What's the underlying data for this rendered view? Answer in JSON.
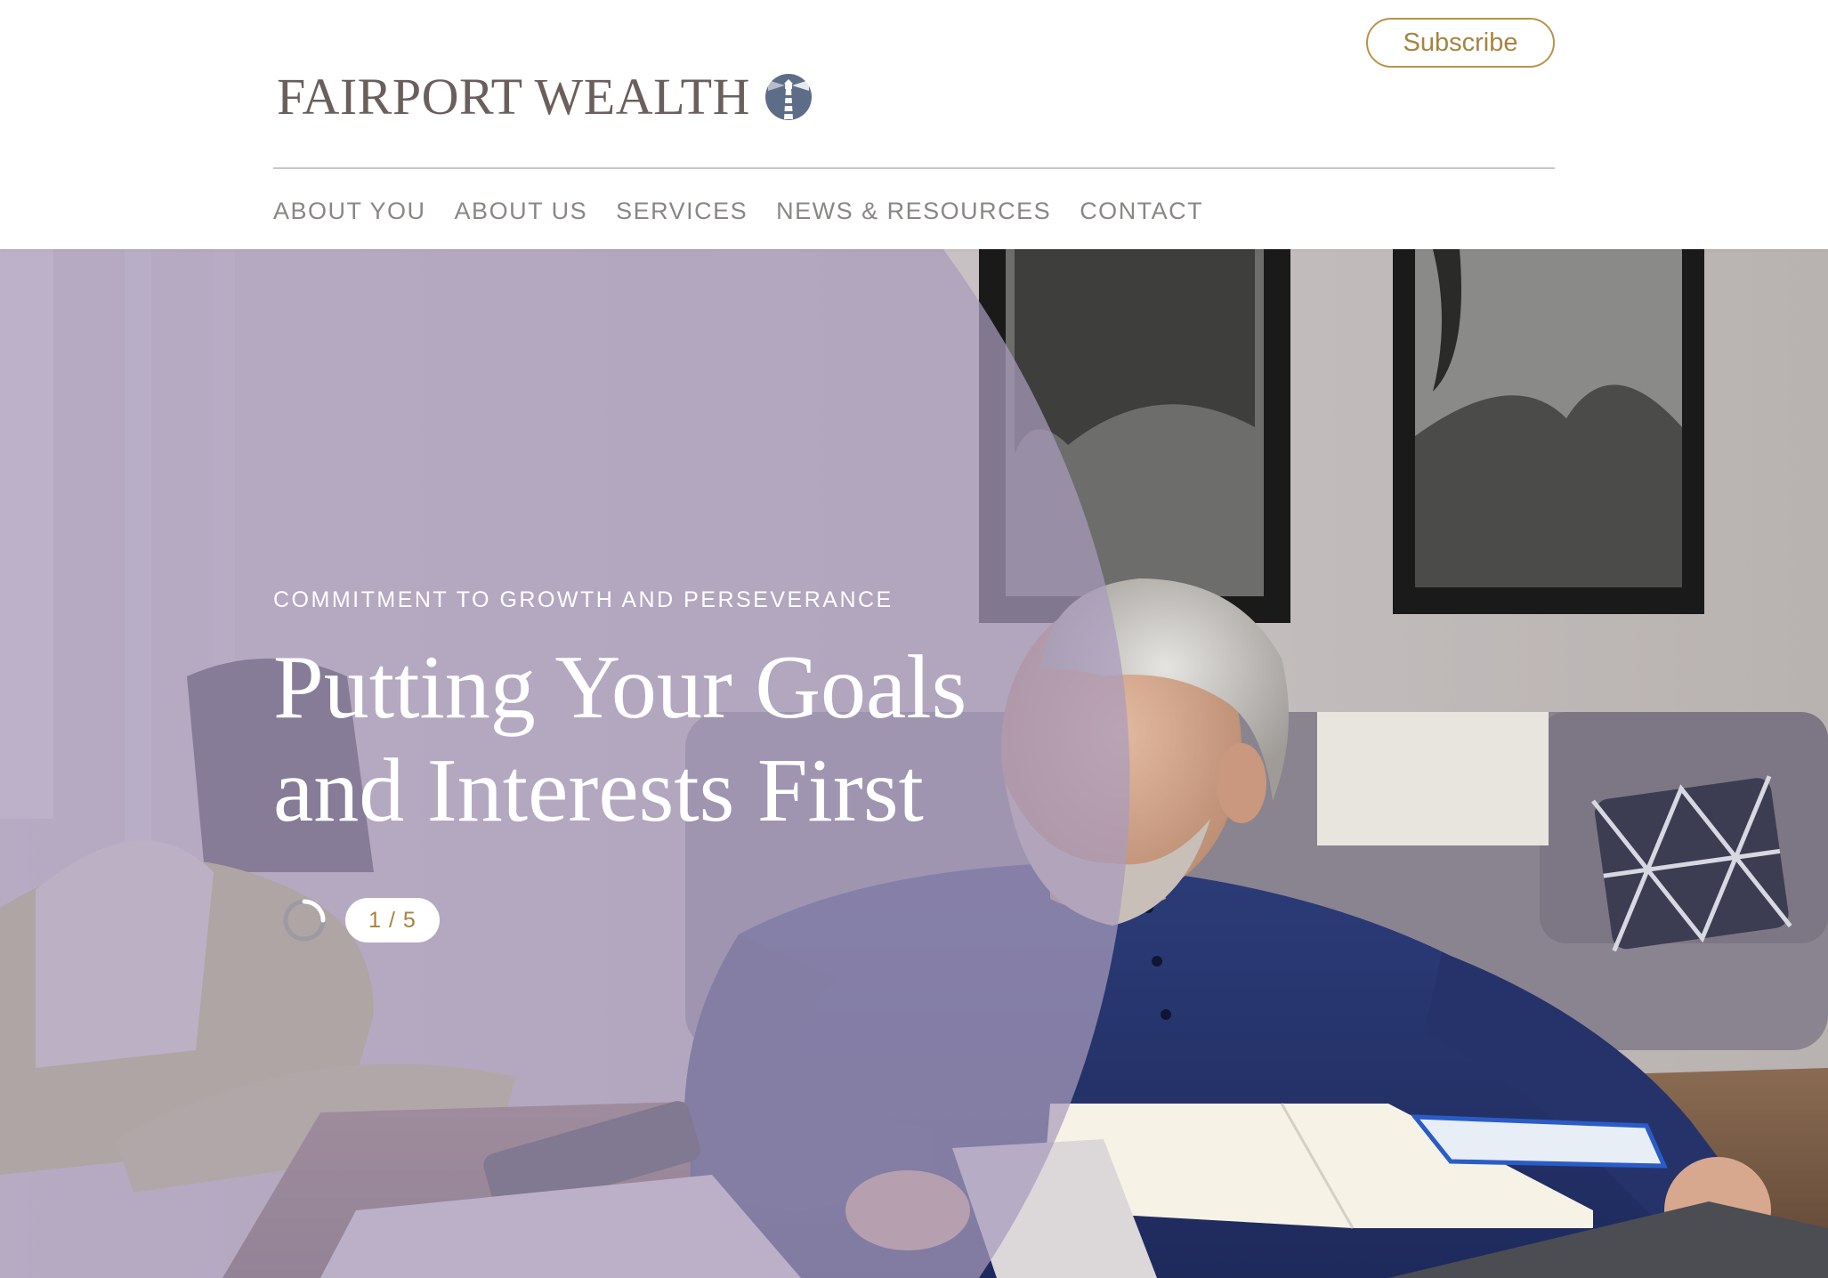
{
  "brand": {
    "name": "FAIRPORT WEALTH",
    "icon": "lighthouse-icon",
    "text_color": "#6a5f5c",
    "icon_color": "#5e6d87"
  },
  "header": {
    "subscribe_label": "Subscribe",
    "accent_color": "#b8934a"
  },
  "nav": {
    "items": [
      {
        "label": "ABOUT YOU"
      },
      {
        "label": "ABOUT US"
      },
      {
        "label": "SERVICES"
      },
      {
        "label": "NEWS & RESOURCES"
      },
      {
        "label": "CONTACT"
      }
    ]
  },
  "hero": {
    "eyebrow": "COMMITMENT TO GROWTH AND PERSEVERANCE",
    "title_line1": "Putting Your Goals",
    "title_line2": "and Interests First",
    "overlay_color": "#a99bbd",
    "image_subject": "man in navy henley sitting at desk with notebook, looking out window"
  },
  "slider": {
    "counter": "1 / 5",
    "current": 1,
    "total": 5,
    "progress": 0.25
  }
}
